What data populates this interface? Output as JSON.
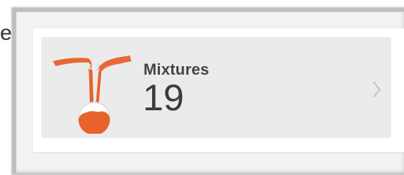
{
  "left_edge_text": "e",
  "tile": {
    "label": "Mixtures",
    "count": "19",
    "icon": "flask-mixing-icon",
    "action_icon": "chevron-right-icon"
  },
  "colors": {
    "accent": "#E8622C",
    "tile_background": "#EBEBEB",
    "text": "#444444",
    "chevron": "#C8C8C8"
  }
}
